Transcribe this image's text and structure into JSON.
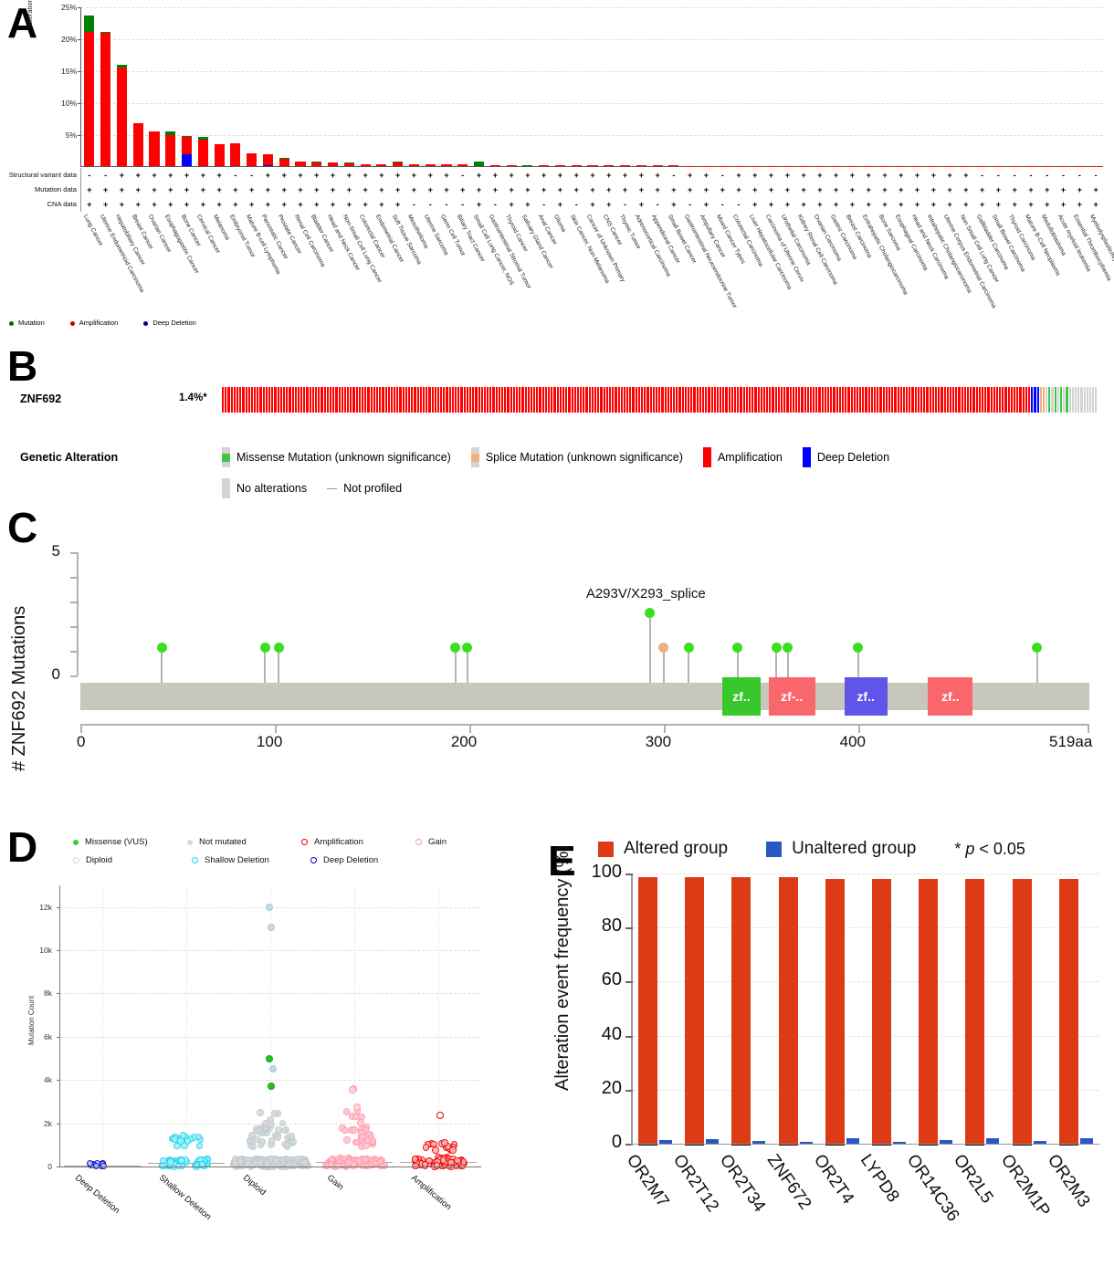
{
  "panelA": {
    "letter": "A",
    "y_axis_label": "Alteration Frequency",
    "y_ticks": [
      "25%",
      "20%",
      "15%",
      "10%",
      "5%"
    ],
    "row_labels": [
      "Structural variant data",
      "Mutation data",
      "CNA data"
    ],
    "legend": [
      {
        "label": "Mutation",
        "color": "#006400"
      },
      {
        "label": "Amplification",
        "color": "#cc0000"
      },
      {
        "label": "Deep Deletion",
        "color": "#00008b"
      }
    ],
    "chart_data": {
      "type": "bar",
      "title": "",
      "xlabel": "",
      "ylabel": "Alteration Frequency",
      "ylim": [
        0,
        25
      ],
      "grid": true,
      "stacked": true,
      "series": [
        {
          "name": "Mutation",
          "color": "#008000"
        },
        {
          "name": "Amplification",
          "color": "#ff0000"
        },
        {
          "name": "Deep Deletion",
          "color": "#0000ff"
        }
      ],
      "categories": [
        "Lung Cancer",
        "Uterine Endometrioid Carcinoma",
        "Hepatobiliary Cancer",
        "Breast Cancer",
        "Ovarian Cancer",
        "Esophagogastric Cancer",
        "Bone Cancer",
        "Cervical Cancer",
        "Melanoma",
        "Embryonal Tumor",
        "Mature B-cell Lymphoma",
        "Pancreatic Cancer",
        "Prostate Cancer",
        "Renal Cell Carcinoma",
        "Bladder Cancer",
        "Head and Neck Cancer",
        "Non-Small Cell Lung Cancer",
        "Colorectal Cancer",
        "Endometrial Cancer",
        "Soft Tissue Sarcoma",
        "Mesothelioma",
        "Uterine Sarcoma",
        "Germ Cell Tumor",
        "Biliary Tract Cancer",
        "Small Cell Lung Cancer, NOS",
        "Gastrointestinal Stromal Tumor",
        "Thyroid Cancer",
        "Salivary Gland Cancer",
        "Anal Cancer",
        "Glioma",
        "Skin Cancer, Non-Melanoma",
        "Cancer of Unknown Primary",
        "CNS Cancer",
        "Thymic Tumor",
        "Adrenocortical Carcinoma",
        "Appendiceal Cancer",
        "Small Bowel Cancer",
        "Gastrointestinal Neuroendocrine Tumor",
        "Ampullary Cancer",
        "Mixed Cancer Types",
        "Colorectal Carcinoma",
        "Liver Hepatocellular Carcinoma",
        "Carcinoma of Uterine Cervix",
        "Urothelial Carcinoma",
        "Kidney Renal Cell Carcinoma",
        "Ovarian Carcinoma",
        "Gastric Carcinoma",
        "Breast Carcinoma",
        "Extrahepatic Cholangiocarcinoma",
        "Bone Sarcoma",
        "Esophageal Carcinoma",
        "Head and Neck Carcinoma",
        "Intrahepatic Cholangiocarcinoma",
        "Uterine Corpus Endometrial Carcinoma",
        "Non Small Cell Lung Cancer",
        "Gallbladder Carcinoma",
        "Small Bowel Carcinoma",
        "Thyroid Carcinoma",
        "Mature B-Cell Neoplasms",
        "Medulloblastoma",
        "Acute myeloid leukemia",
        "Essential Thrombocythemia",
        "Myelodysplastic/Myeloproliferative Neoplasms"
      ],
      "values_mutation": [
        2.6,
        0.15,
        0.35,
        0,
        0,
        0.6,
        0.1,
        0.35,
        0,
        0,
        0,
        0.05,
        0.15,
        0,
        0.1,
        0,
        0.1,
        0.1,
        0,
        0.12,
        0,
        0,
        0,
        0,
        0.7,
        0,
        0,
        0.15,
        0,
        0,
        0,
        0,
        0,
        0,
        0,
        0,
        0,
        0,
        0,
        0,
        0,
        0,
        0,
        0,
        0,
        0,
        0,
        0,
        0,
        0,
        0,
        0,
        0,
        0,
        0,
        0,
        0,
        0,
        0,
        0,
        0,
        0,
        0
      ],
      "values_amplification": [
        21.0,
        20.8,
        15.5,
        6.7,
        5.5,
        4.8,
        2.8,
        4.2,
        3.4,
        3.6,
        2.0,
        1.7,
        1.15,
        0.75,
        0.55,
        0.6,
        0.45,
        0.25,
        0.3,
        0.55,
        0.35,
        0.3,
        0.28,
        0.25,
        0.0,
        0.2,
        0.18,
        0.0,
        0.15,
        0.12,
        0.12,
        0.1,
        0.1,
        0.1,
        0.08,
        0.08,
        0.08,
        0.07,
        0.06,
        0.06,
        0.05,
        0.05,
        0.05,
        0.05,
        0.04,
        0.04,
        0.04,
        0.03,
        0.03,
        0.03,
        0.03,
        0.03,
        0.02,
        0.02,
        0.02,
        0.02,
        0.02,
        0.02,
        0.02,
        0.02,
        0.02,
        0.02,
        0.02
      ],
      "values_deepdeletion": [
        0,
        0,
        0,
        0,
        0,
        0,
        1.8,
        0,
        0,
        0,
        0,
        0.1,
        0,
        0,
        0,
        0,
        0,
        0,
        0,
        0,
        0,
        0,
        0,
        0,
        0,
        0,
        0,
        0,
        0,
        0,
        0,
        0,
        0,
        0,
        0,
        0,
        0,
        0,
        0,
        0,
        0,
        0,
        0,
        0,
        0,
        0,
        0,
        0,
        0,
        0,
        0,
        0,
        0,
        0,
        0,
        0,
        0,
        0,
        0,
        0,
        0,
        0,
        0
      ]
    },
    "structural_variant_data": [
      "-",
      "-",
      "+",
      "+",
      "+",
      "+",
      "+",
      "+",
      "+",
      "-",
      "-",
      "+",
      "+",
      "+",
      "+",
      "+",
      "+",
      "+",
      "+",
      "+",
      "+",
      "+",
      "+",
      "-",
      "+",
      "+",
      "+",
      "+",
      "+",
      "+",
      "+",
      "+",
      "+",
      "+",
      "+",
      "+",
      "-",
      "+",
      "+",
      "-",
      "+",
      "+",
      "+",
      "+",
      "+",
      "+",
      "+",
      "+",
      "+",
      "+",
      "+",
      "+",
      "+",
      "+",
      "+",
      "-",
      "-",
      "-",
      "-",
      "-",
      "-",
      "-",
      "-"
    ],
    "mutation_data": [
      "+",
      "+",
      "+",
      "+",
      "+",
      "+",
      "+",
      "+",
      "+",
      "+",
      "+",
      "+",
      "+",
      "+",
      "+",
      "+",
      "+",
      "+",
      "+",
      "+",
      "+",
      "+",
      "+",
      "+",
      "+",
      "+",
      "+",
      "+",
      "+",
      "+",
      "+",
      "+",
      "+",
      "+",
      "+",
      "+",
      "+",
      "+",
      "+",
      "+",
      "+",
      "+",
      "+",
      "+",
      "+",
      "+",
      "+",
      "+",
      "+",
      "+",
      "+",
      "+",
      "+",
      "+",
      "+",
      "+",
      "+",
      "+",
      "+",
      "+",
      "+",
      "+",
      "+"
    ],
    "cna_data": [
      "+",
      "+",
      "+",
      "+",
      "+",
      "+",
      "+",
      "+",
      "+",
      "+",
      "+",
      "+",
      "+",
      "+",
      "+",
      "+",
      "+",
      "+",
      "+",
      "+",
      "-",
      "-",
      "-",
      "-",
      "+",
      "-",
      "+",
      "+",
      "-",
      "+",
      "-",
      "+",
      "+",
      "-",
      "+",
      "-",
      "+",
      "-",
      "+",
      "-",
      "-",
      "+",
      "+",
      "+",
      "+",
      "+",
      "+",
      "+",
      "+",
      "+",
      "+",
      "+",
      "+",
      "+",
      "+",
      "+",
      "+",
      "+",
      "+",
      "+",
      "+",
      "+",
      "+"
    ]
  },
  "panelB": {
    "letter": "B",
    "gene": "ZNF692",
    "percent": "1.4%*",
    "section_label": "Genetic Alteration",
    "legend": [
      {
        "label": "Missense Mutation (unknown significance)",
        "color": "#3dc83d"
      },
      {
        "label": "Splice Mutation (unknown significance)",
        "color": "#f0b080"
      },
      {
        "label": "Amplification",
        "color": "#ff0000"
      },
      {
        "label": "Deep Deletion",
        "color": "#0000ff"
      },
      {
        "label": "No alterations",
        "color": "#d4d4d4"
      },
      {
        "label": "Not profiled",
        "color": "#bbbbbb"
      }
    ]
  },
  "panelC": {
    "letter": "C",
    "y_axis_label": "# ZNF692 Mutations",
    "y_ticks": [
      "5",
      "0"
    ],
    "ylim": [
      0,
      5
    ],
    "x_ticks": [
      "0",
      "100",
      "200",
      "300",
      "400",
      "519aa"
    ],
    "protein_length": 519,
    "annotation": "A293V/X293_splice",
    "chart_data": {
      "type": "scatter",
      "title": "",
      "xlabel": "",
      "ylabel": "# ZNF692 Mutations",
      "xlim": [
        0,
        519
      ],
      "ylim": [
        0,
        5
      ],
      "mutations": [
        {
          "position": 42,
          "count": 1,
          "type": "missense",
          "color": "#3ddd22"
        },
        {
          "position": 95,
          "count": 1,
          "type": "missense",
          "color": "#3ddd22"
        },
        {
          "position": 102,
          "count": 1,
          "type": "missense",
          "color": "#3ddd22"
        },
        {
          "position": 193,
          "count": 1,
          "type": "missense",
          "color": "#3ddd22"
        },
        {
          "position": 199,
          "count": 1,
          "type": "missense",
          "color": "#3ddd22"
        },
        {
          "position": 293,
          "count": 2,
          "type": "missense",
          "color": "#3ddd22",
          "label": "A293V/X293_splice"
        },
        {
          "position": 300,
          "count": 1,
          "type": "splice",
          "color": "#f0b080"
        },
        {
          "position": 313,
          "count": 1,
          "type": "missense",
          "color": "#3ddd22"
        },
        {
          "position": 338,
          "count": 1,
          "type": "missense",
          "color": "#3ddd22"
        },
        {
          "position": 358,
          "count": 1,
          "type": "missense",
          "color": "#3ddd22"
        },
        {
          "position": 364,
          "count": 1,
          "type": "missense",
          "color": "#3ddd22"
        },
        {
          "position": 400,
          "count": 1,
          "type": "missense",
          "color": "#3ddd22"
        },
        {
          "position": 492,
          "count": 1,
          "type": "missense",
          "color": "#3ddd22"
        }
      ],
      "domains": [
        {
          "label": "zf..",
          "start": 330,
          "end": 350,
          "color": "#3ac62d"
        },
        {
          "label": "zf-..",
          "start": 354,
          "end": 378,
          "color": "#f9676c"
        },
        {
          "label": "zf..",
          "start": 393,
          "end": 415,
          "color": "#5f55e8"
        },
        {
          "label": "zf..",
          "start": 436,
          "end": 459,
          "color": "#f9676c"
        }
      ]
    }
  },
  "panelD": {
    "letter": "D",
    "y_axis_label": "Mutation Count",
    "y_ticks": [
      "12k",
      "10k",
      "8k",
      "6k",
      "4k",
      "2k",
      "0"
    ],
    "legend": [
      {
        "label": "Missense (VUS)",
        "color": "#3dc83d",
        "filled": true
      },
      {
        "label": "Not mutated",
        "color": "#c8dce8",
        "filled": true
      },
      {
        "label": "Amplification",
        "color": "#ee0000",
        "filled": false
      },
      {
        "label": "Gain",
        "color": "#ff9aab",
        "filled": false
      },
      {
        "label": "Diploid",
        "color": "#d8d8d8",
        "filled": false
      },
      {
        "label": "Shallow Deletion",
        "color": "#22d3ee",
        "filled": false
      },
      {
        "label": "Deep Deletion",
        "color": "#0000cc",
        "filled": false
      }
    ],
    "chart_data": {
      "type": "scatter",
      "title": "",
      "xlabel": "",
      "ylabel": "Mutation Count",
      "ylim": [
        0,
        13000
      ],
      "categories": [
        "Deep Deletion",
        "Shallow Deletion",
        "Diploid",
        "Gain",
        "Amplification"
      ],
      "group_colors": [
        "#0000cc",
        "#22d3ee",
        "#d8d8d8",
        "#ff9aab",
        "#ee0000"
      ],
      "group_medians": [
        60,
        180,
        180,
        200,
        220
      ],
      "notable_points": [
        {
          "group": "Diploid",
          "value": 12000,
          "type": "Not mutated"
        },
        {
          "group": "Diploid",
          "value": 11050,
          "type": "Not mutated"
        },
        {
          "group": "Diploid",
          "value": 5000,
          "type": "Missense (VUS)"
        },
        {
          "group": "Diploid",
          "value": 4500,
          "type": "Not mutated"
        },
        {
          "group": "Diploid",
          "value": 3700,
          "type": "Missense (VUS)"
        },
        {
          "group": "Gain",
          "value": 3600,
          "type": "Gain"
        },
        {
          "group": "Gain",
          "value": 3550,
          "type": "Gain"
        },
        {
          "group": "Gain",
          "value": 2750,
          "type": "Gain"
        },
        {
          "group": "Amplification",
          "value": 2350,
          "type": "Amplification"
        }
      ]
    }
  },
  "panelE": {
    "letter": "E",
    "y_axis_label": "Alteration event frequency (%)",
    "y_ticks": [
      "100",
      "80",
      "60",
      "40",
      "20",
      "0"
    ],
    "legend": [
      {
        "label": "Altered group",
        "color": "#dd3b16"
      },
      {
        "label": "Unaltered group",
        "color": "#2a57c4"
      }
    ],
    "pvalue_note_prefix": "*",
    "pvalue_note_italic": "p",
    "pvalue_note_suffix": "< 0.05",
    "chart_data": {
      "type": "bar",
      "title": "",
      "xlabel": "",
      "ylabel": "Alteration event frequency (%)",
      "ylim": [
        0,
        100
      ],
      "grid": true,
      "categories": [
        "OR2M7",
        "OR2T12",
        "OR2T34",
        "ZNF672",
        "OR2T4",
        "LYPD8",
        "OR14C36",
        "OR2L5",
        "OR2M1P",
        "OR2M3"
      ],
      "series": [
        {
          "name": "Altered group",
          "color": "#dd3b16",
          "values": [
            98.5,
            98.5,
            98.5,
            98.5,
            98.0,
            98.0,
            98.0,
            98.0,
            98.0,
            98.0
          ]
        },
        {
          "name": "Unaltered group",
          "color": "#2a57c4",
          "values": [
            1.5,
            1.8,
            1.0,
            0.6,
            2.0,
            0.4,
            1.3,
            1.9,
            1.1,
            1.9
          ]
        }
      ]
    }
  }
}
